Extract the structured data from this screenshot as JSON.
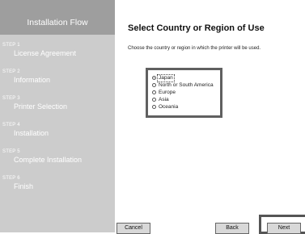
{
  "sidebar": {
    "title": "Installation Flow",
    "steps": [
      {
        "num": "STEP 1",
        "name": "License Agreement"
      },
      {
        "num": "STEP 2",
        "name": "Information"
      },
      {
        "num": "STEP 3",
        "name": "Printer Selection"
      },
      {
        "num": "STEP 4",
        "name": "Installation"
      },
      {
        "num": "STEP 5",
        "name": "Complete Installation"
      },
      {
        "num": "STEP 6",
        "name": "Finish"
      }
    ]
  },
  "main": {
    "title": "Select Country or Region of Use",
    "description": "Choose the country or region in which the printer will be used.",
    "options": [
      {
        "label": "Japan",
        "checked": true
      },
      {
        "label": "North or South America",
        "checked": false
      },
      {
        "label": "Europe",
        "checked": false
      },
      {
        "label": "Asia",
        "checked": false
      },
      {
        "label": "Oceania",
        "checked": false
      }
    ]
  },
  "buttons": {
    "cancel": "Cancel",
    "back": "Back",
    "next": "Next"
  },
  "colors": {
    "sidebar_bg": "#cccccc",
    "sidebar_header_bg": "#9e9e9e",
    "highlight_border": "#606060"
  }
}
